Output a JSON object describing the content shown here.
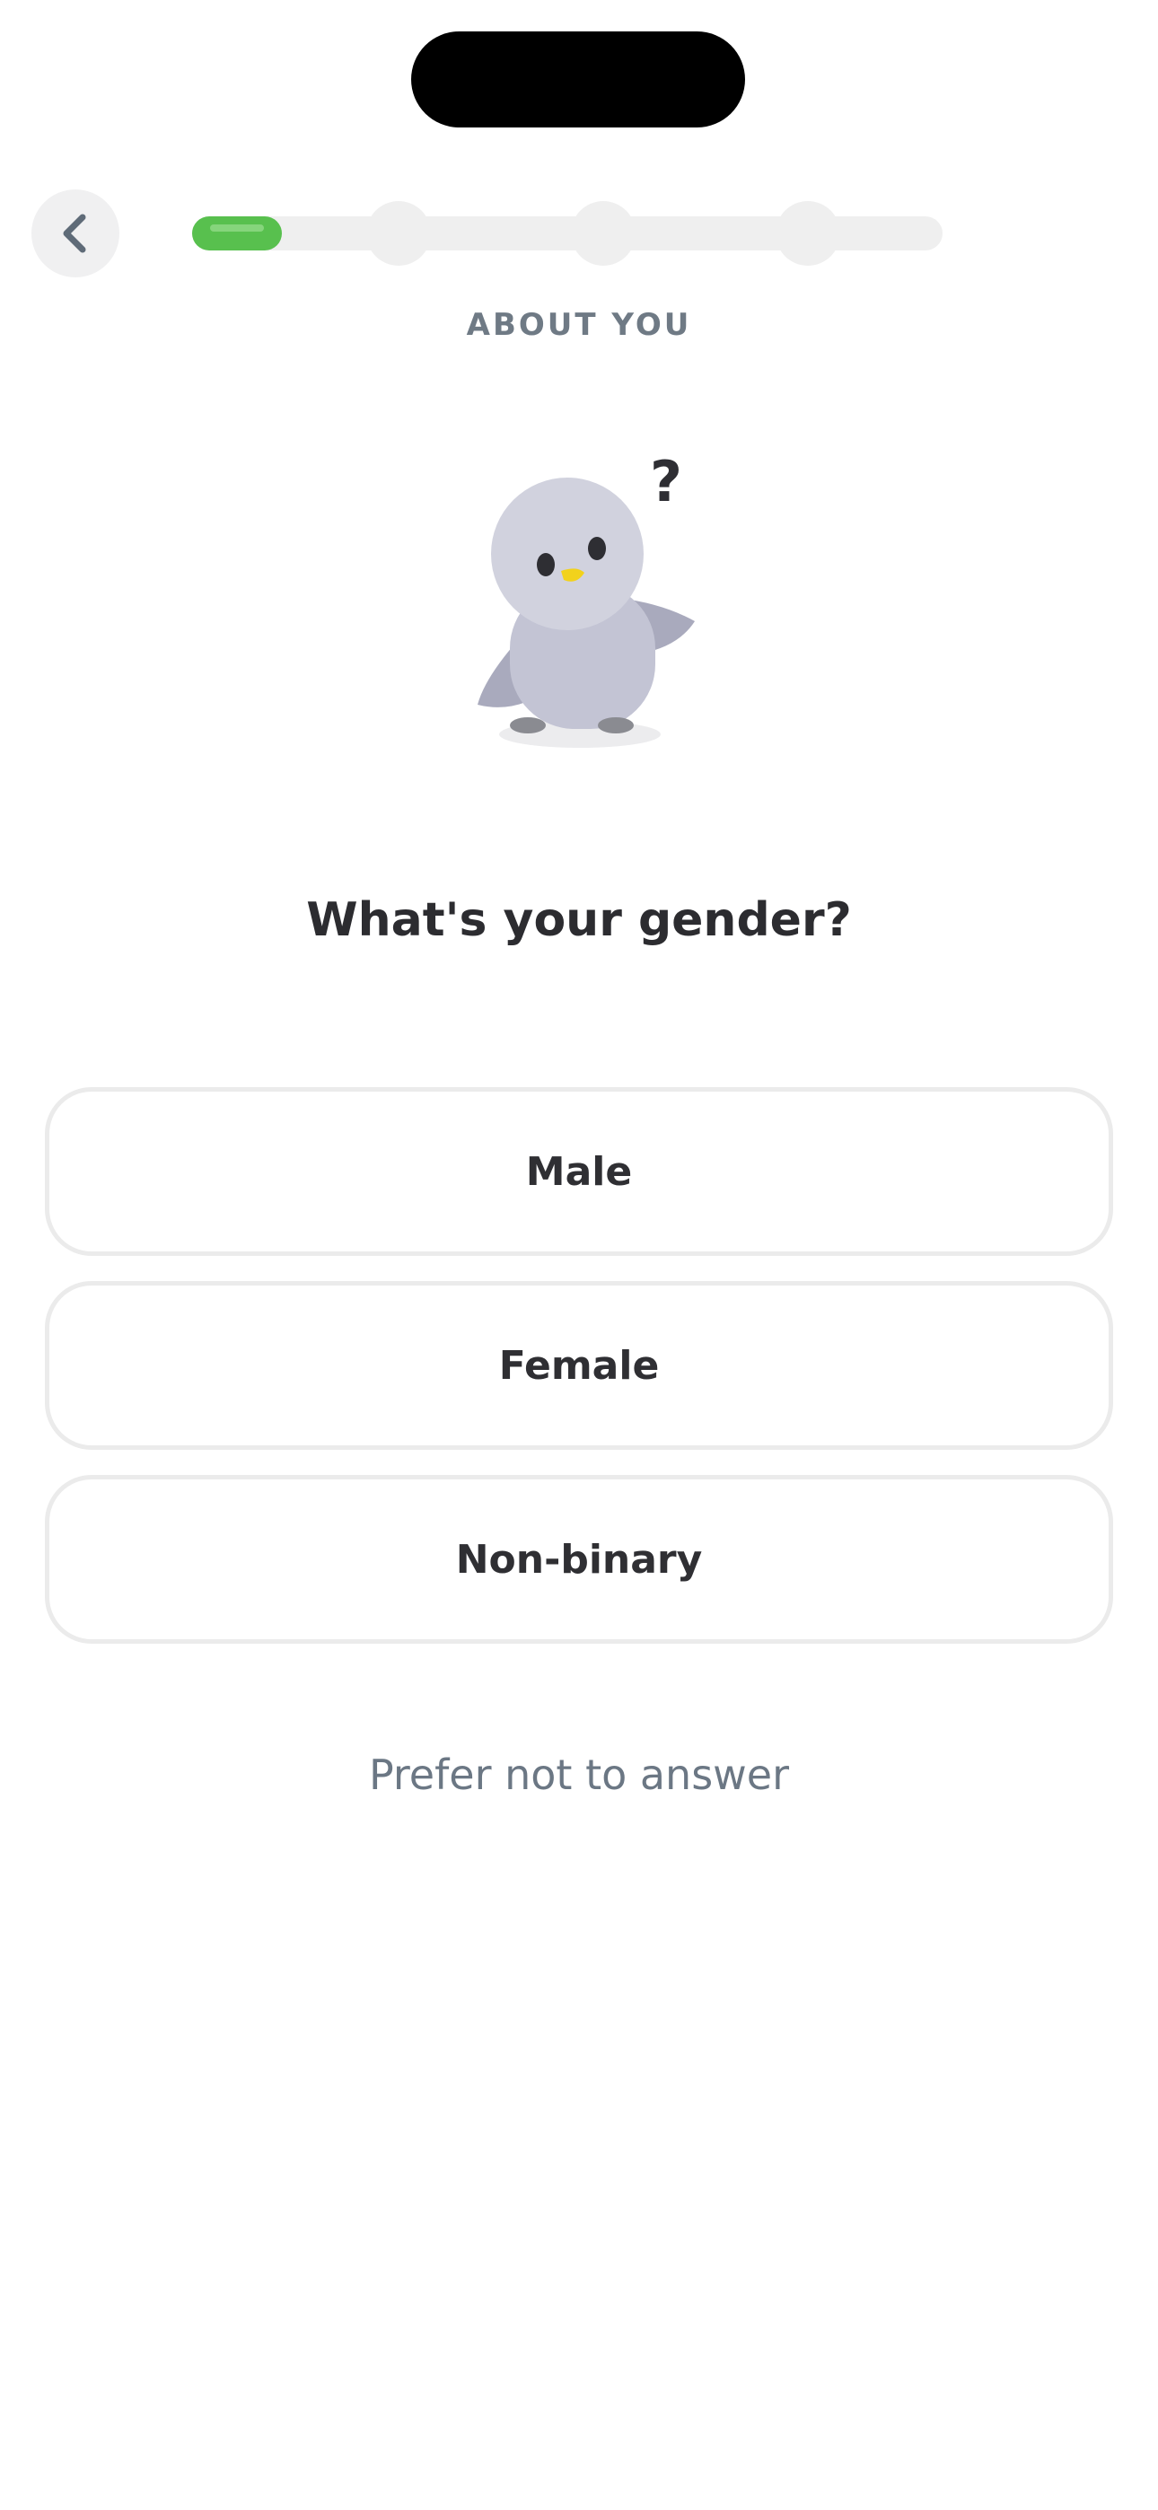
{
  "header": {
    "section_label": "ABOUT YOU"
  },
  "progress": {
    "fraction": 0.08,
    "step_count": 4,
    "color": "#58c04e"
  },
  "question": "What's your gender?",
  "options": [
    {
      "label": "Male"
    },
    {
      "label": "Female"
    },
    {
      "label": "Non-binary"
    }
  ],
  "skip_label": "Prefer not to answer",
  "mascot": {
    "icon": "confused-bird-mascot-icon",
    "badge_text": "?"
  }
}
